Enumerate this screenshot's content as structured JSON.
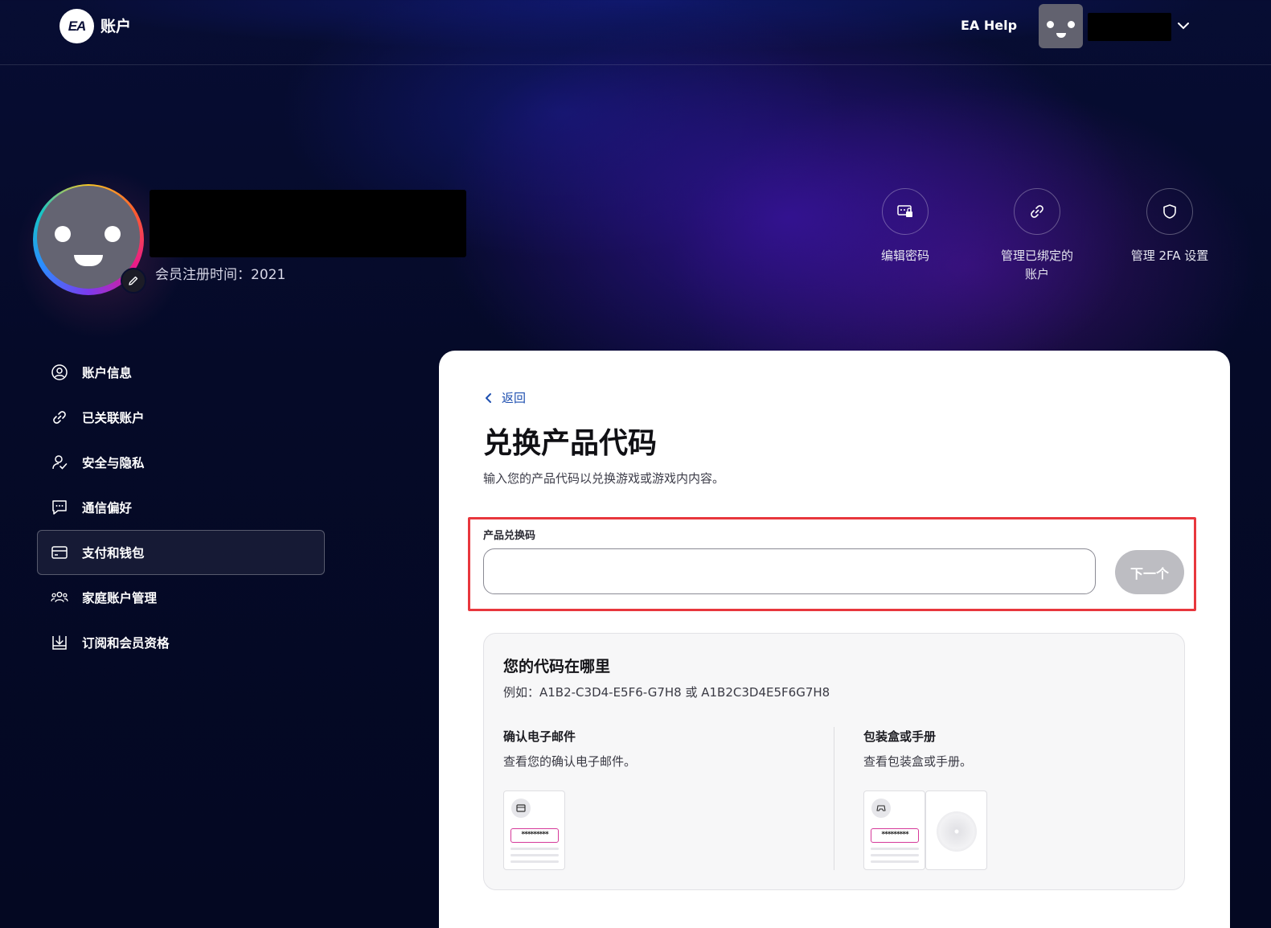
{
  "header": {
    "logo_text": "EA",
    "title": "账户",
    "help_link": "EA Help"
  },
  "profile": {
    "member_since": "会员注册时间：2021"
  },
  "quick_actions": [
    {
      "label": "编辑密码",
      "icon": "password-icon"
    },
    {
      "label": "管理已绑定的\n账户",
      "icon": "link-icon"
    },
    {
      "label": "管理 2FA 设置",
      "icon": "shield-icon"
    }
  ],
  "sidebar": {
    "items": [
      {
        "label": "账户信息",
        "icon": "user-circle-icon"
      },
      {
        "label": "已关联账户",
        "icon": "link-icon"
      },
      {
        "label": "安全与隐私",
        "icon": "security-icon"
      },
      {
        "label": "通信偏好",
        "icon": "chat-icon"
      },
      {
        "label": "支付和钱包",
        "icon": "wallet-icon",
        "active": true
      },
      {
        "label": "家庭账户管理",
        "icon": "family-icon"
      },
      {
        "label": "订阅和会员资格",
        "icon": "download-box-icon"
      }
    ]
  },
  "main": {
    "back_label": "返回",
    "title": "兑换产品代码",
    "description": "输入您的产品代码以兑换游戏或游戏内内容。",
    "field_label": "产品兑换码",
    "input_value": "",
    "next_label": "下一个",
    "info": {
      "title": "您的代码在哪里",
      "example": "例如：A1B2-C3D4-E5F6-G7H8 或 A1B2C3D4E5F6G7H8",
      "col1_title": "确认电子邮件",
      "col1_desc": "查看您的确认电子邮件。",
      "col2_title": "包装盒或手册",
      "col2_desc": "查看包装盒或手册。",
      "masked_code": "*********"
    }
  },
  "colors": {
    "highlight": "#e8373d",
    "link": "#1e4fb0",
    "next_disabled": "#bdbdc2",
    "code_border": "#d63a9a"
  }
}
